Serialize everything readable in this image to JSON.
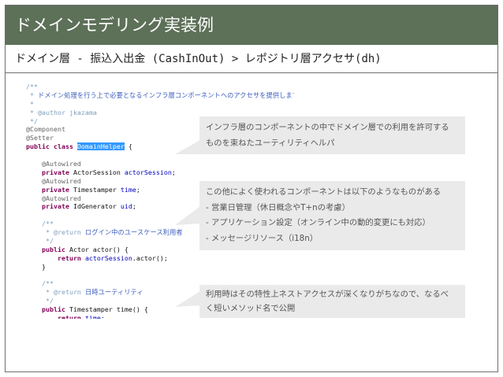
{
  "header": {
    "title": "ドメインモデリング実装例",
    "breadcrumb": "ドメイン層 - 振込入出金 (CashInOut) > レポジトリ層アクセサ(dh)"
  },
  "code": {
    "lines": [
      [
        {
          "t": "/**",
          "c": "c-doc"
        }
      ],
      [
        {
          "t": " * ",
          "c": "c-doc"
        },
        {
          "t": "ドメイン処理を行う上で必要となるインフラ層コンポーネントへのアクセサを提供します。",
          "c": "c-jp"
        }
      ],
      [
        {
          "t": " *",
          "c": "c-doc"
        }
      ],
      [
        {
          "t": " * @author jkazama",
          "c": "c-doc"
        }
      ],
      [
        {
          "t": " */",
          "c": "c-doc"
        }
      ],
      [
        {
          "t": "@Component",
          "c": "c-ann"
        }
      ],
      [
        {
          "t": "@Setter",
          "c": "c-ann"
        }
      ],
      [
        {
          "t": "public class ",
          "c": "c-kw"
        },
        {
          "t": "DomainHelper",
          "c": "c-hl"
        },
        {
          "t": " {",
          "c": ""
        }
      ],
      [
        {
          "t": "",
          "c": ""
        }
      ],
      [
        {
          "t": "    @Autowired",
          "c": "c-ann"
        }
      ],
      [
        {
          "t": "    private ",
          "c": "c-kw"
        },
        {
          "t": "ActorSession ",
          "c": ""
        },
        {
          "t": "actorSession",
          "c": "c-field"
        },
        {
          "t": ";",
          "c": ""
        }
      ],
      [
        {
          "t": "    @Autowired",
          "c": "c-ann"
        }
      ],
      [
        {
          "t": "    private ",
          "c": "c-kw"
        },
        {
          "t": "Timestamper ",
          "c": ""
        },
        {
          "t": "time",
          "c": "c-field"
        },
        {
          "t": ";",
          "c": ""
        }
      ],
      [
        {
          "t": "    @Autowired",
          "c": "c-ann"
        }
      ],
      [
        {
          "t": "    private ",
          "c": "c-kw"
        },
        {
          "t": "IdGenerator ",
          "c": ""
        },
        {
          "t": "uid",
          "c": "c-field"
        },
        {
          "t": ";",
          "c": ""
        }
      ],
      [
        {
          "t": "",
          "c": ""
        }
      ],
      [
        {
          "t": "    /**",
          "c": "c-doc"
        }
      ],
      [
        {
          "t": "     * @return ",
          "c": "c-doc"
        },
        {
          "t": "ログイン中のユースケース利用者",
          "c": "c-jp"
        }
      ],
      [
        {
          "t": "     */",
          "c": "c-doc"
        }
      ],
      [
        {
          "t": "    public ",
          "c": "c-kw"
        },
        {
          "t": "Actor actor() {",
          "c": ""
        }
      ],
      [
        {
          "t": "        return ",
          "c": "c-kw"
        },
        {
          "t": "actorSession",
          "c": "c-field"
        },
        {
          "t": ".actor();",
          "c": ""
        }
      ],
      [
        {
          "t": "    }",
          "c": ""
        }
      ],
      [
        {
          "t": "",
          "c": ""
        }
      ],
      [
        {
          "t": "    /**",
          "c": "c-doc"
        }
      ],
      [
        {
          "t": "     * @return ",
          "c": "c-doc"
        },
        {
          "t": "日時ユーティリティ",
          "c": "c-jp"
        }
      ],
      [
        {
          "t": "     */",
          "c": "c-doc"
        }
      ],
      [
        {
          "t": "    public ",
          "c": "c-kw"
        },
        {
          "t": "Timestamper time() {",
          "c": ""
        }
      ],
      [
        {
          "t": "        return ",
          "c": "c-kw"
        },
        {
          "t": "time",
          "c": "c-field"
        },
        {
          "t": ";",
          "c": ""
        }
      ]
    ]
  },
  "callouts": {
    "c1": [
      "インフラ層のコンポーネントの中でドメイン層での利用を許可する",
      "ものを束ねたユーティリティヘルパ"
    ],
    "c2": [
      "この他によく使われるコンポーネントは以下のようなものがある",
      "- 営業日管理（休日概念やT+nの考慮）",
      "- アプリケーション設定（オンライン中の動的変更にも対応）",
      "- メッセージリソース（i18n）"
    ],
    "c3": [
      "利用時はその特性上ネストアクセスが深くなりがちなので、なるべ",
      "く短いメソッド名で公開"
    ]
  }
}
